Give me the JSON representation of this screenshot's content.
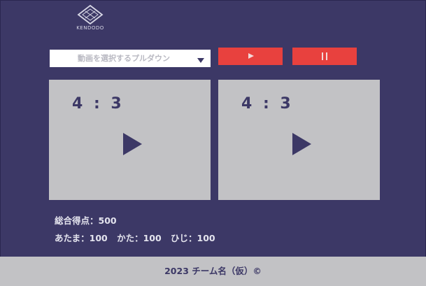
{
  "logo": {
    "text": "KENDODO"
  },
  "controls": {
    "video_select_placeholder": "動画を選択するプルダウン",
    "play_icon": "play-icon",
    "pause_icon": "pause-icon"
  },
  "videos": [
    {
      "aspect_label": "4 : 3",
      "icon": "play-icon"
    },
    {
      "aspect_label": "4 : 3",
      "icon": "play-icon"
    }
  ],
  "scores": {
    "total": "総合得点：500",
    "head": "あたま：100",
    "shoulder": "かた：100",
    "elbow": "ひじ：100"
  },
  "footer": {
    "text": "2023 チーム名（仮）©"
  },
  "colors": {
    "background": "#3c3866",
    "panel": "#c2c2c5",
    "accent": "#e8413e",
    "select_bg": "#ffffff"
  }
}
